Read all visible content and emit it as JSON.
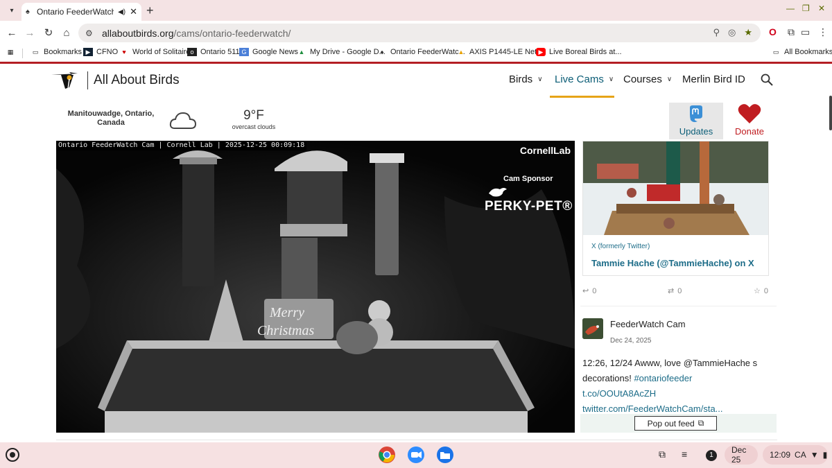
{
  "browser": {
    "tab": {
      "title": "Ontario FeederWatch Cam",
      "close": "✕"
    },
    "new_tab": "+",
    "url_host": "allaboutbirds.org",
    "url_path": "/cams/ontario-feederwatch/",
    "bookmarks": [
      "Bookmarks",
      "CFNO",
      "World of Solitaire",
      "Ontario 511",
      "Google News",
      "My Drive - Google D...",
      "Ontario FeederWatc...",
      "AXIS P1445-LE Net...",
      "Live Boreal Birds at..."
    ],
    "all_bookmarks": "All Bookmarks"
  },
  "site": {
    "logo_text": "All About Birds",
    "nav": [
      {
        "label": "Birds",
        "chevron": true,
        "active": false
      },
      {
        "label": "Live Cams",
        "chevron": true,
        "active": true
      },
      {
        "label": "Courses",
        "chevron": true,
        "active": false
      },
      {
        "label": "Merlin Bird ID",
        "chevron": false,
        "active": false
      }
    ]
  },
  "weather": {
    "location": "Manitouwadge, Ontario, Canada",
    "temperature": "9°F",
    "condition": "overcast clouds"
  },
  "actions": {
    "updates": "Updates",
    "donate": "Donate"
  },
  "video": {
    "overlay": "Ontario FeederWatch Cam | Cornell Lab | 2025-12-25 00:09:18",
    "brand": "CornellLab",
    "sponsor_label": "Cam Sponsor",
    "sponsor_name": "PERKY-PET®"
  },
  "feed": {
    "card_source": "X (formerly Twitter)",
    "card_link": "Tammie Hache (@TammieHache) on X",
    "counts": {
      "reply": "0",
      "repost": "0",
      "like": "0"
    },
    "post": {
      "author": "FeederWatch Cam",
      "date": "Dec 24, 2025",
      "text": "12:26, 12/24  Awww, love @TammieHache s decorations! ",
      "hashtag": "#ontariofeeder",
      "link1": "t.co/OOUtA8AcZH",
      "link2": "twitter.com/FeederWatchCam/sta..."
    },
    "popout": "Pop out feed"
  },
  "shelf": {
    "notifications": "1",
    "date": "Dec 25",
    "time": "12:09",
    "region": "CA"
  },
  "colors": {
    "accent": "#0a5c75",
    "brand_red": "#b41f24",
    "underline": "#e6a417",
    "donate": "#c01d21"
  }
}
